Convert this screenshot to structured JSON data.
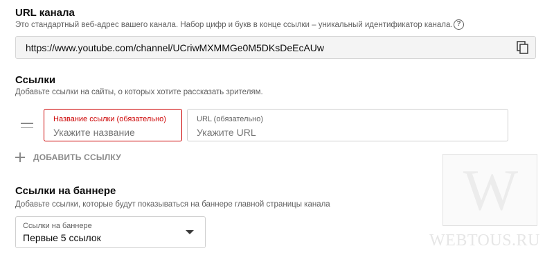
{
  "url_section": {
    "title": "URL канала",
    "description": "Это стандартный веб-адрес вашего канала. Набор цифр и букв в конце ссылки – уникальный идентификатор канала.",
    "help_icon": "question-circle-icon",
    "help_glyph": "?",
    "url": "https://www.youtube.com/channel/UCriwMXMMGe0M5DKsDeEcAUw",
    "copy_icon": "copy-icon"
  },
  "links_section": {
    "title": "Ссылки",
    "description": "Добавьте ссылки на сайты, о которых хотите рассказать зрителям.",
    "drag_icon": "drag-handle-icon",
    "name_field": {
      "label": "Название ссылки (обязательно)",
      "placeholder": "Укажите название",
      "value": ""
    },
    "url_field": {
      "label": "URL (обязательно)",
      "placeholder": "Укажите URL",
      "value": ""
    },
    "add_link_label": "ДОБАВИТЬ ССЫЛКУ",
    "add_icon": "plus-icon"
  },
  "banner_section": {
    "title": "Ссылки на баннере",
    "description": "Добавьте ссылки, которые будут показываться на баннере главной страницы канала",
    "select": {
      "label": "Ссылки на баннере",
      "value": "Первые 5 ссылок",
      "icon": "caret-down-icon"
    }
  },
  "watermark": {
    "letter": "W",
    "text": "WEBTOUS.RU"
  },
  "colors": {
    "error": "#cc0000",
    "muted_text": "#606060",
    "url_background": "#f4f4f4"
  }
}
